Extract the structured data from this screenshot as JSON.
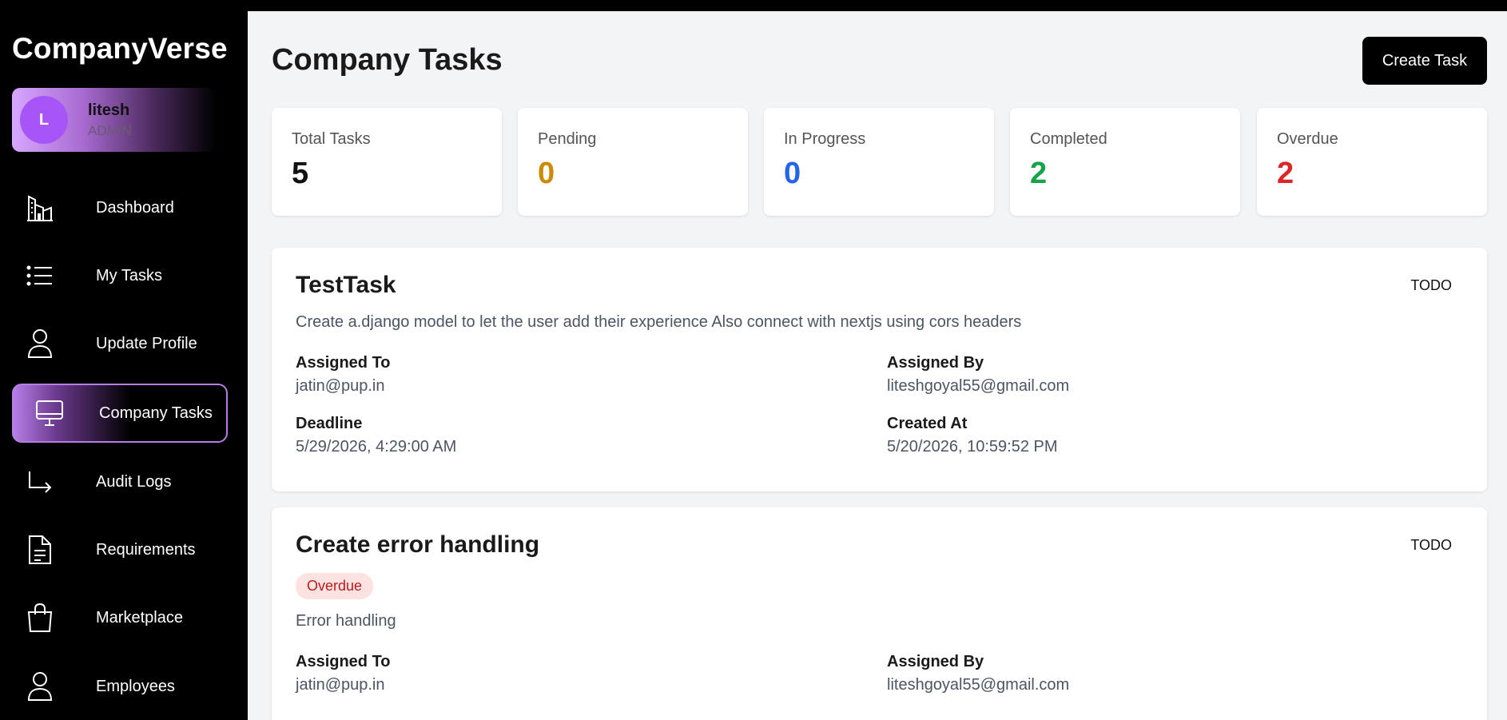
{
  "brand": "CompanyVerse",
  "user": {
    "initial": "L",
    "name": "litesh",
    "role": "ADMIN"
  },
  "nav": [
    {
      "label": "Dashboard",
      "icon": "building-icon"
    },
    {
      "label": "My Tasks",
      "icon": "list-icon"
    },
    {
      "label": "Update Profile",
      "icon": "user-icon"
    },
    {
      "label": "Company Tasks",
      "icon": "monitor-icon",
      "active": true
    },
    {
      "label": "Audit Logs",
      "icon": "corner-arrow-icon"
    },
    {
      "label": "Requirements",
      "icon": "document-icon"
    },
    {
      "label": "Marketplace",
      "icon": "shopping-bag-icon"
    },
    {
      "label": "Employees",
      "icon": "user-icon"
    }
  ],
  "page": {
    "title": "Company Tasks",
    "create_label": "Create Task"
  },
  "stats": [
    {
      "label": "Total Tasks",
      "value": "5",
      "color": "#111111"
    },
    {
      "label": "Pending",
      "value": "0",
      "color": "#ca8a04"
    },
    {
      "label": "In Progress",
      "value": "0",
      "color": "#2563eb"
    },
    {
      "label": "Completed",
      "value": "2",
      "color": "#16a34a"
    },
    {
      "label": "Overdue",
      "value": "2",
      "color": "#dc2626"
    }
  ],
  "field_labels": {
    "assigned_to": "Assigned To",
    "assigned_by": "Assigned By",
    "deadline": "Deadline",
    "created_at": "Created At"
  },
  "tasks": [
    {
      "title": "TestTask",
      "status": "TODO",
      "badge": "",
      "description": "Create a.django model to let the user add their experience Also connect with nextjs using cors headers",
      "assigned_to": "jatin@pup.in",
      "assigned_by": "liteshgoyal55@gmail.com",
      "deadline": "5/29/2026, 4:29:00 AM",
      "created_at": "5/20/2026, 10:59:52 PM"
    },
    {
      "title": "Create error handling",
      "status": "TODO",
      "badge": "Overdue",
      "description": "Error handling",
      "assigned_to": "jatin@pup.in",
      "assigned_by": "liteshgoyal55@gmail.com"
    }
  ]
}
